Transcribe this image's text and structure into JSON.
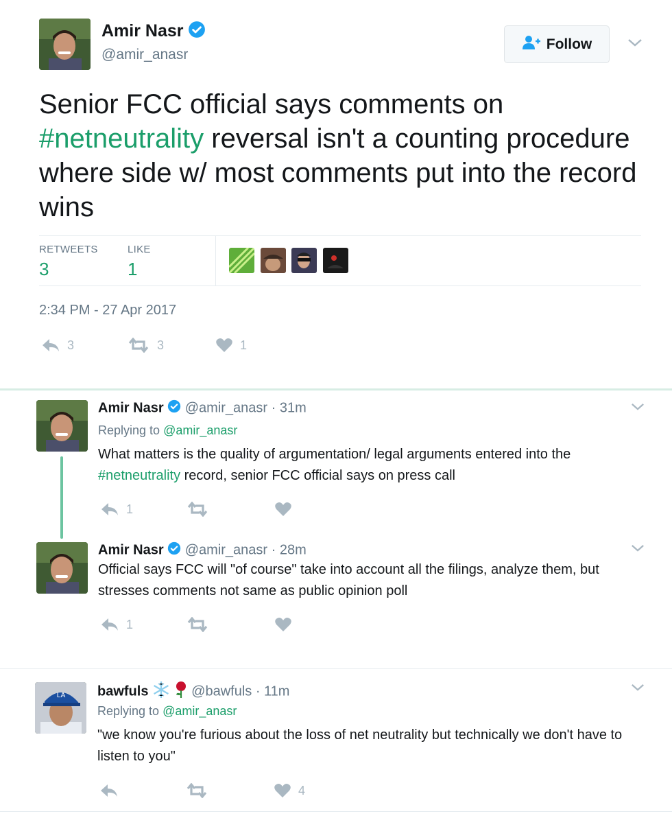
{
  "main_tweet": {
    "author_name": "Amir Nasr",
    "author_handle": "@amir_anasr",
    "follow_label": "Follow",
    "text_part1": "Senior FCC official says comments on ",
    "hashtag": "#netneutrality",
    "text_part2": " reversal isn't a counting procedure where side w/ most comments put into the record wins",
    "retweets_label": "RETWEETS",
    "retweets_count": "3",
    "likes_label": "LIKE",
    "likes_count": "1",
    "timestamp": "2:34 PM - 27 Apr 2017",
    "actions": {
      "reply_count": "3",
      "retweet_count": "3",
      "like_count": "1"
    }
  },
  "replies": [
    {
      "author_name": "Amir Nasr",
      "author_handle": "@amir_anasr",
      "time": "· 31m",
      "replying_prefix": "Replying to ",
      "replying_to": "@amir_anasr",
      "text_part1": "What matters is the quality of argumentation/ legal arguments entered into the ",
      "hashtag": "#netneutrality",
      "text_part2": " record, senior FCC official says on press call",
      "reply_count": "1",
      "retweet_count": "",
      "like_count": ""
    },
    {
      "author_name": "Amir Nasr",
      "author_handle": "@amir_anasr",
      "time": "· 28m",
      "text": "Official says FCC will \"of course\" take into account all the filings, analyze them, but stresses comments not same as public opinion poll",
      "reply_count": "1",
      "retweet_count": "",
      "like_count": ""
    },
    {
      "author_name": "bawfuls",
      "author_handle": "@bawfuls",
      "time": "· 11m",
      "replying_prefix": "Replying to ",
      "replying_to": "@amir_anasr",
      "text": "\"we know you're furious about the loss of net neutrality but technically we don't have to listen to you\"",
      "reply_count": "",
      "retweet_count": "",
      "like_count": "4"
    }
  ],
  "colors": {
    "accent": "#1b9e6a",
    "verified": "#1da1f2",
    "muted": "#657786",
    "icon": "#aab8c2"
  },
  "icons": [
    "verified-icon",
    "add-user-icon",
    "chevron-down-icon",
    "reply-icon",
    "retweet-icon",
    "heart-icon",
    "snowflake-icon",
    "rose-icon"
  ]
}
